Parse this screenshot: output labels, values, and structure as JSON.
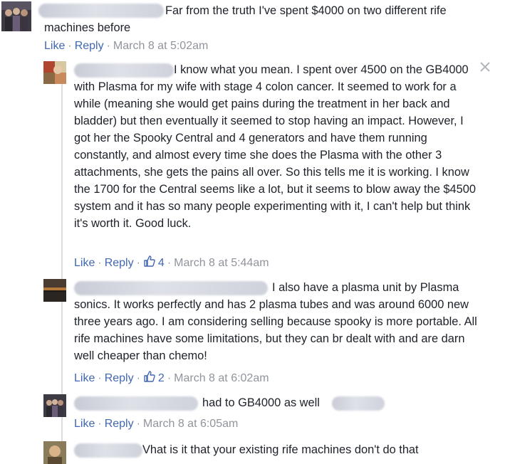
{
  "comments": [
    {
      "text": "Far from the truth I've spent $4000 on two different rife machines before",
      "actions": {
        "like": "Like",
        "reply": "Reply",
        "time": "March 8 at 5:02am"
      }
    },
    {
      "text": "I know what you mean. I spent over 4500 on the GB4000 with Plasma for my wife with stage 4 colon cancer. It seemed to work for a while (meaning she would get pains during the treatment in her back and bladder) but then eventually it seemed to stop having an impact. However, I got her the Spooky Central and 4 generators and have them running constantly, and almost every time she does the Plasma with the other 3 attachments, she gets the pains all over. So this tells me it is working. I know the 1700 for the Central seems like a lot, but it seems to blow away the $4500 system and it has so many people experimenting with it, I can't help but think it's worth it. Good luck.",
      "actions": {
        "like": "Like",
        "reply": "Reply",
        "likes": "4",
        "time": "March 8 at 5:44am"
      }
    },
    {
      "text": "I also have a plasma unit by Plasma sonics. It works perfectly and has 2 plasma tubes and was around 6000 new three years ago. I am considering selling because spooky is more portable. All rife machines have some limitations, but they can br dealt with and are darn well cheaper than chemo!",
      "actions": {
        "like": "Like",
        "reply": "Reply",
        "likes": "2",
        "time": "March 8 at 6:02am"
      }
    },
    {
      "text": "had to GB4000 as well",
      "actions": {
        "like": "Like",
        "reply": "Reply",
        "time": "March 8 at 6:05am"
      }
    },
    {
      "text": "Vhat is it that your existing rife machines don't do that"
    }
  ],
  "colors": {
    "link": "#4267b2",
    "meta": "#90949c",
    "text": "#1d2129",
    "thread": "#dadde1"
  },
  "icons": {
    "close": "close-icon",
    "like": "thumbs-up-icon"
  }
}
